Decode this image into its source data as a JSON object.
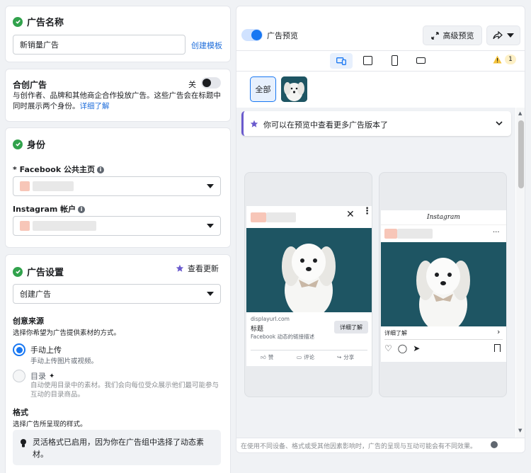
{
  "ad_name": {
    "title": "广告名称",
    "value": "新销量广告",
    "create_template": "创建模板"
  },
  "co_create": {
    "title": "合创广告",
    "toggle_label": "关",
    "description": "与创作者、品牌和其他商企合作投放广告。这些广告会在标题中同时展示两个身份。",
    "learn_more": "详细了解"
  },
  "identity": {
    "title": "身份",
    "facebook_label": "* Facebook 公共主页",
    "instagram_label": "Instagram 帐户"
  },
  "ad_settings": {
    "title": "广告设置",
    "view_updates": "查看更新",
    "create_option": "创建广告",
    "creative_source_title": "创意来源",
    "creative_source_desc": "选择你希望为广告提供素材的方式。",
    "manual_upload_title": "手动上传",
    "manual_upload_desc": "手动上传图片或视频。",
    "catalog_title": "目录",
    "catalog_desc": "自动使用目录中的素材。我们会向每位受众展示他们最可能参与互动的目录商品。",
    "format_title": "格式",
    "format_desc": "选择广告所呈现的样式。",
    "format_notice": "灵活格式已启用，因为你在广告组中选择了动态素材。"
  },
  "preview": {
    "toggle_label": "广告预览",
    "advanced_preview": "高级预览",
    "warning_count": "1",
    "all_label": "全部",
    "banner_text": "你可以在预览中查看更多广告版本了",
    "footer_text": "在使用不同设备、格式或受其他因素影响时，广告的呈现与互动可能会有不同效果。"
  },
  "fb_card": {
    "domain": "displayurl.com",
    "headline": "标题",
    "description": "Facebook 动态的链接描述",
    "cta": "详细了解",
    "like": "赞",
    "comment": "评论",
    "share": "分享"
  },
  "ig_card": {
    "logo": "Instagram",
    "cta": "详细了解"
  },
  "colors": {
    "accent": "#1877f2",
    "success": "#31a24c",
    "image_bg": "#1e5563"
  }
}
